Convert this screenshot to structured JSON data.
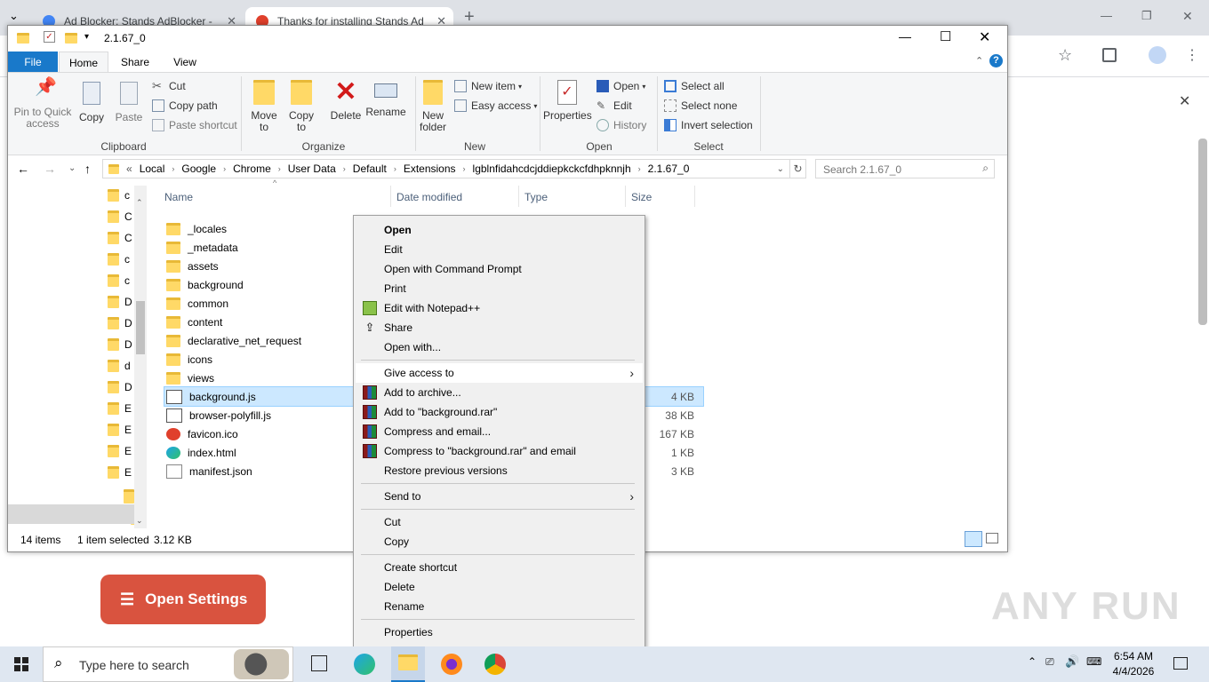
{
  "chrome": {
    "tabs": [
      {
        "title": "Ad Blocker: Stands AdBlocker -",
        "close": "✕"
      },
      {
        "title": "Thanks for installing Stands Ad",
        "close": "✕"
      }
    ],
    "new_tab": "+",
    "window_controls": {
      "minimize": "—",
      "restore": "❐",
      "close": "✕"
    },
    "dropdown": "⌄"
  },
  "explorer": {
    "title": "2.1.67_0",
    "window_controls": {
      "minimize": "—",
      "maximize": "☐",
      "close": "✕"
    },
    "ribbon_tabs": [
      "File",
      "Home",
      "Share",
      "View"
    ],
    "clipboard": {
      "pin": "Pin to Quick access",
      "copy": "Copy",
      "paste": "Paste",
      "cut": "Cut",
      "copy_path": "Copy path",
      "paste_shortcut": "Paste shortcut",
      "group": "Clipboard"
    },
    "organize": {
      "move_to": "Move to",
      "copy_to": "Copy to",
      "delete": "Delete",
      "rename": "Rename",
      "group": "Organize"
    },
    "new": {
      "new_folder": "New folder",
      "new_item": "New item",
      "easy_access": "Easy access",
      "group": "New"
    },
    "open": {
      "properties": "Properties",
      "open": "Open",
      "edit": "Edit",
      "history": "History",
      "group": "Open"
    },
    "select": {
      "select_all": "Select all",
      "select_none": "Select none",
      "invert_selection": "Invert selection",
      "group": "Select"
    },
    "address": {
      "prefix": "«",
      "crumbs": [
        "Local",
        "Google",
        "Chrome",
        "User Data",
        "Default",
        "Extensions",
        "lgblnfidahcdcjddiepkckcfdhpknnjh",
        "2.1.67_0"
      ],
      "search_placeholder": "Search 2.1.67_0"
    },
    "nav_items": [
      "c",
      "C",
      "C",
      "c",
      "c",
      "D",
      "D",
      "D",
      "d",
      "D",
      "E",
      "E",
      "E",
      "E"
    ],
    "columns": {
      "name": "Name",
      "date": "Date modified",
      "type": "Type",
      "size": "Size"
    },
    "files": [
      {
        "name": "_locales",
        "kind": "folder",
        "size": ""
      },
      {
        "name": "_metadata",
        "kind": "folder",
        "size": ""
      },
      {
        "name": "assets",
        "kind": "folder",
        "size": ""
      },
      {
        "name": "background",
        "kind": "folder",
        "size": ""
      },
      {
        "name": "common",
        "kind": "folder",
        "size": ""
      },
      {
        "name": "content",
        "kind": "folder",
        "size": ""
      },
      {
        "name": "declarative_net_request",
        "kind": "folder",
        "size": ""
      },
      {
        "name": "icons",
        "kind": "folder",
        "size": ""
      },
      {
        "name": "views",
        "kind": "folder",
        "size": ""
      },
      {
        "name": "background.js",
        "kind": "js",
        "size": "4 KB"
      },
      {
        "name": "browser-polyfill.js",
        "kind": "js",
        "size": "38 KB"
      },
      {
        "name": "favicon.ico",
        "kind": "ico",
        "size": "167 KB"
      },
      {
        "name": "index.html",
        "kind": "html",
        "size": "1 KB"
      },
      {
        "name": "manifest.json",
        "kind": "json",
        "size": "3 KB"
      }
    ],
    "status": {
      "count": "14 items",
      "selected": "1 item selected",
      "size": "3.12 KB"
    }
  },
  "context_menu": {
    "items": [
      {
        "label": "Open",
        "bold": true
      },
      {
        "label": "Edit"
      },
      {
        "label": "Open with Command Prompt"
      },
      {
        "label": "Print"
      },
      {
        "label": "Edit with Notepad++",
        "icon": "notepad-icon"
      },
      {
        "label": "Share",
        "icon": "share-icon"
      },
      {
        "label": "Open with..."
      },
      {
        "label": "Give access to",
        "submenu": true
      },
      {
        "label": "Add to archive...",
        "icon": "winrar-icon"
      },
      {
        "label": "Add to \"background.rar\"",
        "icon": "winrar-icon"
      },
      {
        "label": "Compress and email...",
        "icon": "winrar-icon"
      },
      {
        "label": "Compress to \"background.rar\" and email",
        "icon": "winrar-icon"
      },
      {
        "label": "Restore previous versions"
      },
      {
        "label": "Send to",
        "submenu": true
      },
      {
        "label": "Cut"
      },
      {
        "label": "Copy"
      },
      {
        "label": "Create shortcut"
      },
      {
        "label": "Delete"
      },
      {
        "label": "Rename"
      },
      {
        "label": "Properties"
      }
    ]
  },
  "page": {
    "open_settings": "Open Settings",
    "watermark": "ANY RUN"
  },
  "taskbar": {
    "search_placeholder": "Type here to search",
    "time": "6:54 AM",
    "date": "4/4/2026"
  },
  "colors": {
    "accent": "#1a73e8",
    "settings_button": "#d9533f",
    "selection": "#cce8ff"
  }
}
